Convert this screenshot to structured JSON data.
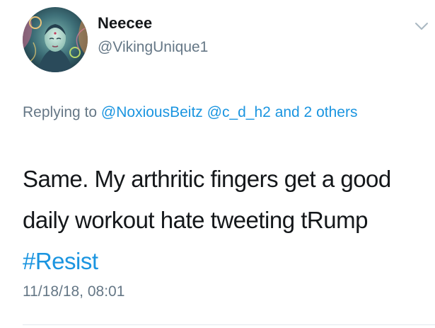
{
  "user": {
    "display_name": "Neecee",
    "handle": "@VikingUnique1",
    "avatar_icon": "profile-avatar-artwork"
  },
  "reply_context": {
    "prefix": "Replying to",
    "mention_1": "@NoxiousBeitz",
    "mention_2": "@c_d_h2",
    "others": "and 2 others"
  },
  "tweet": {
    "text": "Same. My arthritic fingers get a good daily workout hate tweeting tRump",
    "hashtag": "#Resist",
    "timestamp": "11/18/18, 08:01"
  },
  "icons": {
    "menu": "chevron-down-icon"
  },
  "colors": {
    "link": "#1b95e0",
    "secondary_text": "#657786",
    "primary_text": "#14171a"
  }
}
